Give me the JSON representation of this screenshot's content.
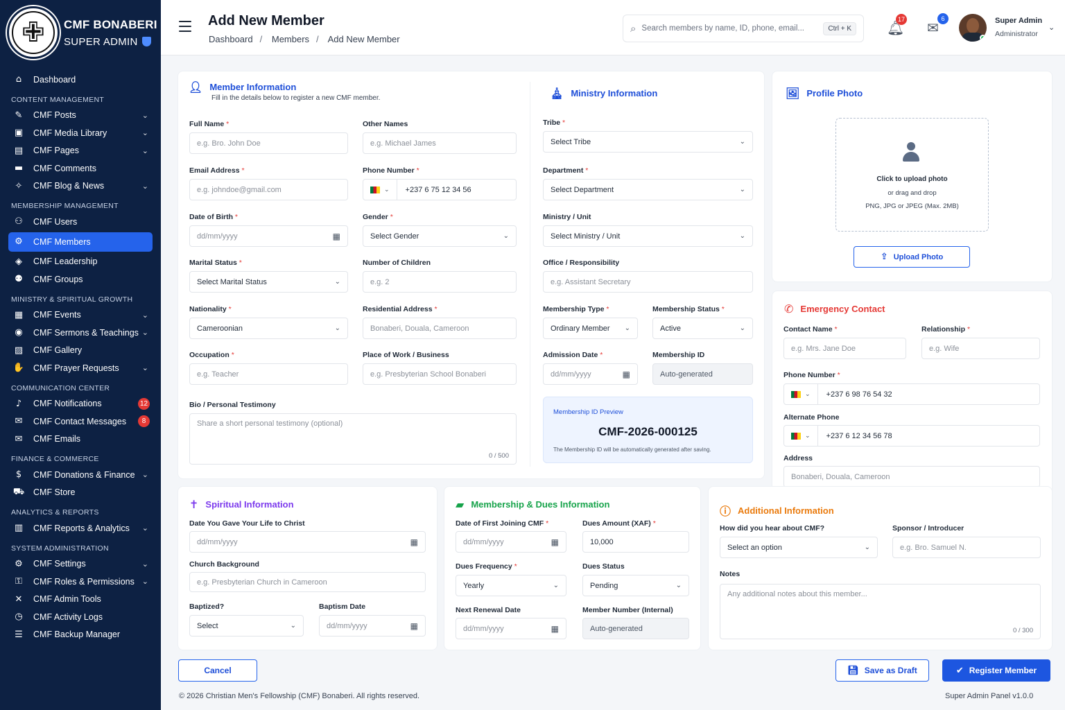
{
  "brand": {
    "name": "CMF BONABERI",
    "role": "SUPER ADMIN"
  },
  "nav": {
    "dashboard": "Dashboard",
    "sections": {
      "content": "CONTENT MANAGEMENT",
      "membership": "MEMBERSHIP MANAGEMENT",
      "ministry": "MINISTRY & SPIRITUAL GROWTH",
      "communication": "COMMUNICATION CENTER",
      "finance": "FINANCE & COMMERCE",
      "analytics": "ANALYTICS & REPORTS",
      "system": "SYSTEM ADMINISTRATION"
    },
    "items": {
      "posts": "CMF Posts",
      "media": "CMF Media Library",
      "pages": "CMF Pages",
      "comments": "CMF Comments",
      "blog": "CMF Blog & News",
      "users": "CMF Users",
      "members": "CMF Members",
      "leadership": "CMF Leadership",
      "groups": "CMF Groups",
      "events": "CMF Events",
      "sermons": "CMF Sermons & Teachings",
      "gallery": "CMF Gallery",
      "prayer": "CMF Prayer Requests",
      "notifications": "CMF Notifications",
      "contact": "CMF Contact Messages",
      "emails": "CMF Emails",
      "donations": "CMF Donations & Finance",
      "store": "CMF Store",
      "reports": "CMF Reports & Analytics",
      "settings": "CMF Settings",
      "roles": "CMF Roles & Permissions",
      "admin_tools": "CMF Admin Tools",
      "activity": "CMF Activity Logs",
      "backup": "CMF Backup Manager"
    },
    "badges": {
      "notifications": "12",
      "contact": "8"
    }
  },
  "header": {
    "title": "Add New Member",
    "breadcrumb": [
      "Dashboard",
      "Members",
      "Add New Member"
    ],
    "search_placeholder": "Search members by name, ID, phone, email...",
    "search_shortcut": "Ctrl + K",
    "notif_count": "17",
    "mail_count": "6",
    "user_name": "Super Admin",
    "user_role": "Administrator"
  },
  "member": {
    "title": "Member Information",
    "subtitle": "Fill in the details below to register a new CMF member.",
    "full_name": {
      "label": "Full Name",
      "placeholder": "e.g. Bro. John Doe"
    },
    "other_names": {
      "label": "Other Names",
      "placeholder": "e.g. Michael James"
    },
    "email": {
      "label": "Email Address",
      "placeholder": "e.g. johndoe@gmail.com"
    },
    "phone": {
      "label": "Phone Number",
      "value": "+237 6 75 12 34 56"
    },
    "dob": {
      "label": "Date of Birth",
      "placeholder": "dd/mm/yyyy"
    },
    "gender": {
      "label": "Gender",
      "value": "Select Gender"
    },
    "marital": {
      "label": "Marital Status",
      "value": "Select Marital Status"
    },
    "children": {
      "label": "Number of Children",
      "placeholder": "e.g. 2"
    },
    "nationality": {
      "label": "Nationality",
      "value": "Cameroonian"
    },
    "address": {
      "label": "Residential Address",
      "placeholder": "Bonaberi, Douala, Cameroon"
    },
    "occupation": {
      "label": "Occupation",
      "placeholder": "e.g. Teacher"
    },
    "workplace": {
      "label": "Place of Work / Business",
      "placeholder": "e.g. Presbyterian School Bonaberi"
    },
    "bio": {
      "label": "Bio / Personal Testimony",
      "placeholder": "Share a short personal testimony (optional)",
      "count": "0 / 500"
    }
  },
  "ministry": {
    "title": "Ministry Information",
    "tribe": {
      "label": "Tribe",
      "value": "Select Tribe"
    },
    "department": {
      "label": "Department",
      "value": "Select Department"
    },
    "unit": {
      "label": "Ministry / Unit",
      "value": "Select Ministry / Unit"
    },
    "office": {
      "label": "Office / Responsibility",
      "placeholder": "e.g. Assistant Secretary"
    },
    "type": {
      "label": "Membership Type",
      "value": "Ordinary Member"
    },
    "status": {
      "label": "Membership Status",
      "value": "Active"
    },
    "admission": {
      "label": "Admission Date",
      "placeholder": "dd/mm/yyyy"
    },
    "member_id": {
      "label": "Membership ID",
      "value": "Auto-generated"
    },
    "preview": {
      "label": "Membership ID Preview",
      "value": "CMF-2026-000125",
      "note": "The Membership ID will be automatically generated after saving."
    }
  },
  "photo": {
    "title": "Profile Photo",
    "line1": "Click to upload photo",
    "line2": "or drag and drop",
    "line3": "PNG, JPG or JPEG (Max. 2MB)",
    "button": "Upload Photo"
  },
  "emergency": {
    "title": "Emergency Contact",
    "name": {
      "label": "Contact Name",
      "placeholder": "e.g. Mrs. Jane Doe"
    },
    "relationship": {
      "label": "Relationship",
      "placeholder": "e.g. Wife"
    },
    "phone": {
      "label": "Phone Number",
      "value": "+237 6 98 76 54 32"
    },
    "alt_phone": {
      "label": "Alternate Phone",
      "value": "+237 6 12 34 56 78"
    },
    "address": {
      "label": "Address",
      "placeholder": "Bonaberi, Douala, Cameroon"
    }
  },
  "spiritual": {
    "title": "Spiritual Information",
    "christ_date": {
      "label": "Date You Gave Your Life to Christ",
      "placeholder": "dd/mm/yyyy"
    },
    "church": {
      "label": "Church Background",
      "placeholder": "e.g. Presbyterian Church in Cameroon"
    },
    "baptized": {
      "label": "Baptized?",
      "value": "Select"
    },
    "baptism_date": {
      "label": "Baptism Date",
      "placeholder": "dd/mm/yyyy"
    }
  },
  "dues": {
    "title": "Membership & Dues Information",
    "first_join": {
      "label": "Date of First Joining CMF",
      "placeholder": "dd/mm/yyyy"
    },
    "amount": {
      "label": "Dues Amount (XAF)",
      "value": "10,000"
    },
    "frequency": {
      "label": "Dues Frequency",
      "value": "Yearly"
    },
    "status": {
      "label": "Dues Status",
      "value": "Pending"
    },
    "renewal": {
      "label": "Next Renewal Date",
      "placeholder": "dd/mm/yyyy"
    },
    "internal": {
      "label": "Member Number (Internal)",
      "value": "Auto-generated"
    }
  },
  "additional": {
    "title": "Additional Information",
    "heard": {
      "label": "How did you hear about CMF?",
      "value": "Select an option"
    },
    "sponsor": {
      "label": "Sponsor / Introducer",
      "placeholder": "e.g. Bro. Samuel N."
    },
    "notes": {
      "label": "Notes",
      "placeholder": "Any additional notes about this member...",
      "count": "0 / 300"
    }
  },
  "actions": {
    "cancel": "Cancel",
    "draft": "Save as Draft",
    "register": "Register Member"
  },
  "footer": {
    "copyright": "© 2026 Christian Men's Fellowship (CMF) Bonaberi. All rights reserved.",
    "version": "Super Admin Panel v1.0.0"
  },
  "colors": {
    "sidebar": "#0d2143",
    "accent": "#2563eb",
    "spiritual": "#7c3aed",
    "dues": "#16a34a",
    "additional": "#ea7a0c",
    "emergency": "#e53935"
  }
}
